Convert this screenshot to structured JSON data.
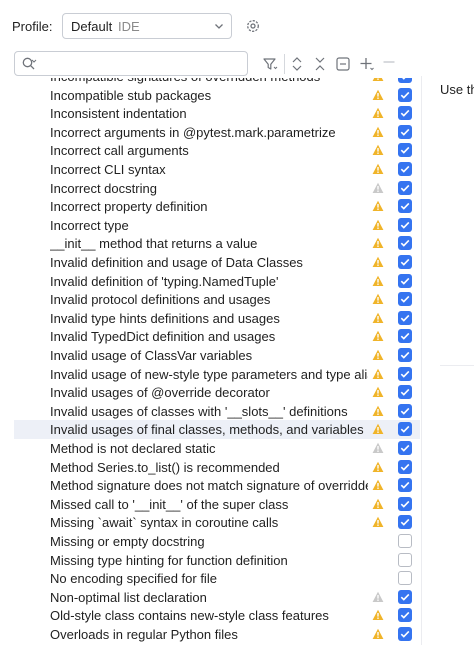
{
  "profile": {
    "label": "Profile:",
    "value": "Default",
    "kind": "IDE"
  },
  "search": {
    "placeholder": ""
  },
  "toolbar": {
    "icons": [
      "filter-icon",
      "expand-all-icon",
      "collapse-all-icon",
      "remove-icon",
      "add-icon",
      "minus-icon"
    ]
  },
  "details": {
    "text": "Use th"
  },
  "colors": {
    "accent": "#3574f0",
    "warning": "#f0b429",
    "weak_warning": "#c9c9c9",
    "selection": "#edf0f7"
  },
  "inspections": [
    {
      "label": "Incompatible signatures of overridden methods",
      "severity": "warning",
      "enabled": true,
      "partial": true
    },
    {
      "label": "Incompatible stub packages",
      "severity": "warning",
      "enabled": true
    },
    {
      "label": "Inconsistent indentation",
      "severity": "warning",
      "enabled": true
    },
    {
      "label": "Incorrect arguments in @pytest.mark.parametrize",
      "severity": "warning",
      "enabled": true
    },
    {
      "label": "Incorrect call arguments",
      "severity": "warning",
      "enabled": true
    },
    {
      "label": "Incorrect CLI syntax",
      "severity": "warning",
      "enabled": true
    },
    {
      "label": "Incorrect docstring",
      "severity": "weak",
      "enabled": true
    },
    {
      "label": "Incorrect property definition",
      "severity": "warning",
      "enabled": true
    },
    {
      "label": "Incorrect type",
      "severity": "warning",
      "enabled": true
    },
    {
      "label": "__init__ method that returns a value",
      "severity": "warning",
      "enabled": true
    },
    {
      "label": "Invalid definition and usage of Data Classes",
      "severity": "warning",
      "enabled": true
    },
    {
      "label": "Invalid definition of 'typing.NamedTuple'",
      "severity": "warning",
      "enabled": true
    },
    {
      "label": "Invalid protocol definitions and usages",
      "severity": "warning",
      "enabled": true
    },
    {
      "label": "Invalid type hints definitions and usages",
      "severity": "warning",
      "enabled": true
    },
    {
      "label": "Invalid TypedDict definition and usages",
      "severity": "warning",
      "enabled": true
    },
    {
      "label": "Invalid usage of ClassVar variables",
      "severity": "warning",
      "enabled": true
    },
    {
      "label": "Invalid usage of new-style type parameters and type aliases",
      "severity": "warning",
      "enabled": true
    },
    {
      "label": "Invalid usages of @override decorator",
      "severity": "warning",
      "enabled": true
    },
    {
      "label": "Invalid usages of classes with '__slots__' definitions",
      "severity": "warning",
      "enabled": true
    },
    {
      "label": "Invalid usages of final classes, methods, and variables",
      "severity": "warning",
      "enabled": true,
      "selected": true
    },
    {
      "label": "Method is not declared static",
      "severity": "weak",
      "enabled": true
    },
    {
      "label": "Method Series.to_list() is recommended",
      "severity": "warning",
      "enabled": true
    },
    {
      "label": "Method signature does not match signature of overridden method",
      "severity": "warning",
      "enabled": true
    },
    {
      "label": "Missed call to '__init__' of the super class",
      "severity": "warning",
      "enabled": true
    },
    {
      "label": "Missing `await` syntax in coroutine calls",
      "severity": "warning",
      "enabled": true
    },
    {
      "label": "Missing or empty docstring",
      "severity": "none",
      "enabled": false
    },
    {
      "label": "Missing type hinting for function definition",
      "severity": "none",
      "enabled": false
    },
    {
      "label": "No encoding specified for file",
      "severity": "none",
      "enabled": false
    },
    {
      "label": "Non-optimal list declaration",
      "severity": "weak",
      "enabled": true
    },
    {
      "label": "Old-style class contains new-style class features",
      "severity": "warning",
      "enabled": true
    },
    {
      "label": "Overloads in regular Python files",
      "severity": "warning",
      "enabled": true
    }
  ]
}
